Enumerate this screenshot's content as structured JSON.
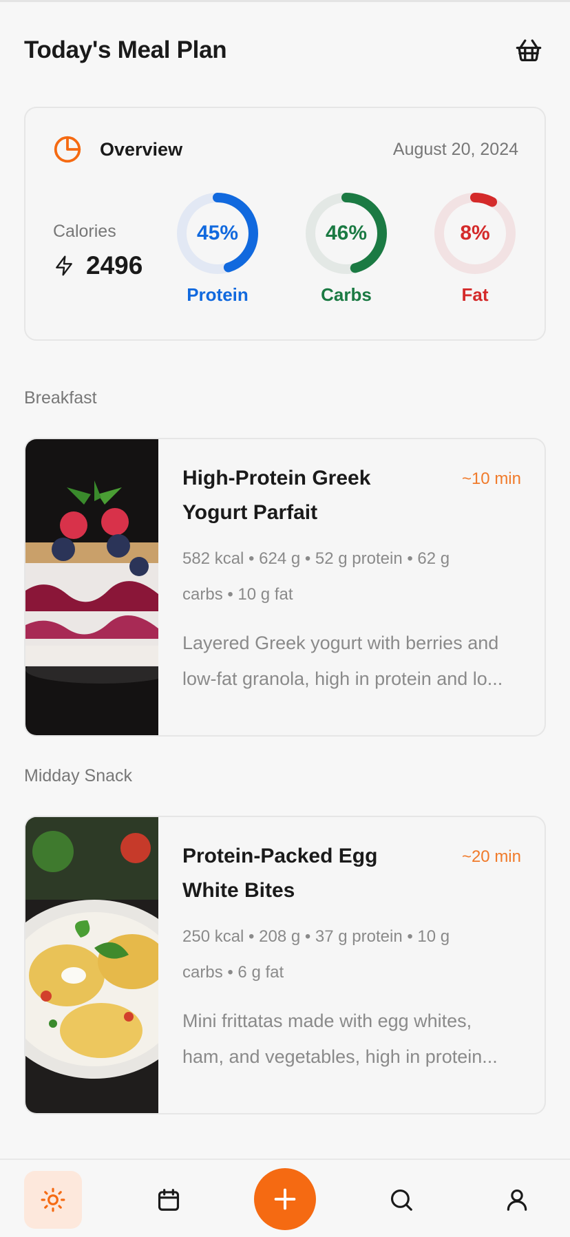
{
  "header": {
    "title": "Today's Meal Plan"
  },
  "overview": {
    "title": "Overview",
    "date": "August 20, 2024",
    "calories_label": "Calories",
    "calories_value": "2496",
    "rings": [
      {
        "label": "Protein",
        "percent_text": "45%",
        "percent": 45,
        "color": "#1169de",
        "track": "#e2e8f4"
      },
      {
        "label": "Carbs",
        "percent_text": "46%",
        "percent": 46,
        "color": "#1b7a43",
        "track": "#e3e8e5"
      },
      {
        "label": "Fat",
        "percent_text": "8%",
        "percent": 8,
        "color": "#d42a2a",
        "track": "#f2e2e3"
      }
    ]
  },
  "meals": [
    {
      "section": "Breakfast",
      "name_line1": "High-Protein Greek",
      "name_line2": "Yogurt Parfait",
      "time": "~10 min",
      "macros_line1": "582 kcal • 624 g • 52 g protein • 62 g",
      "macros_line2": "carbs • 10 g fat",
      "desc_line1": "Layered Greek yogurt with berries and",
      "desc_line2": "low-fat granola, high in protein and lo..."
    },
    {
      "section": "Midday Snack",
      "name_line1": "Protein-Packed Egg",
      "name_line2": "White Bites",
      "time": "~20 min",
      "macros_line1": "250 kcal • 208 g • 37 g protein • 10 g",
      "macros_line2": "carbs • 6 g fat",
      "desc_line1": "Mini frittatas made with egg whites,",
      "desc_line2": "ham, and vegetables, high in protein..."
    }
  ],
  "nav": {
    "items": [
      "sun-icon",
      "calendar-icon",
      "plus-icon",
      "search-icon",
      "user-icon"
    ],
    "accent": "#f56a12"
  }
}
